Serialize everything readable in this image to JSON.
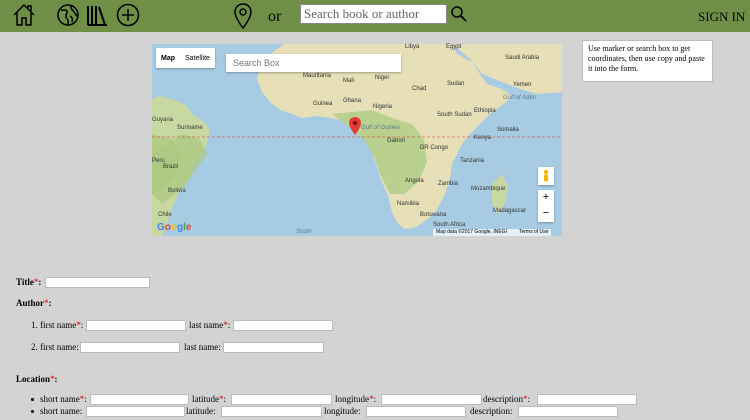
{
  "header": {
    "or_text": "or",
    "search_placeholder": "Search book or author",
    "sign_in": "SIGN IN"
  },
  "map": {
    "type_map": "Map",
    "type_satellite": "Satellite",
    "search_placeholder": "Search Box",
    "google_logo": "Google",
    "attribution": "Map data ©2017 Google, INEGI",
    "terms": "Terms of Use",
    "zoom_in": "+",
    "zoom_out": "−",
    "labels": {
      "libya": "Libya",
      "egypt": "Egypt",
      "mauritania": "Mauritania",
      "mali": "Mali",
      "niger": "Niger",
      "chad": "Chad",
      "sudan": "Sudan",
      "saudi_arabia": "Saudi Arabia",
      "yemen": "Yemen",
      "guinea": "Guinea",
      "ghana": "Ghana",
      "nigeria": "Nigeria",
      "gulf_aden": "Gulf of Aden",
      "ethiopia": "Ethiopia",
      "south_sudan": "South Sudan",
      "gulf_guinea": "Gulf of Guinea",
      "somalia": "Somalia",
      "guyana": "Guyana",
      "suriname": "Suriname",
      "gabon": "Gabon",
      "dr_congo": "DR Congo",
      "kenya": "Kenya",
      "tanzania": "Tanzania",
      "peru": "Peru",
      "brazil": "Brazil",
      "angola": "Angola",
      "zambia": "Zambia",
      "bolivia": "Bolivia",
      "mozambique": "Mozambique",
      "namibia": "Namibia",
      "madagascar": "Madagascar",
      "botswana": "Botswana",
      "chile": "Chile",
      "south_africa": "South Africa",
      "south_atlantic": "South"
    }
  },
  "hint": "Use marker or search box to get coordinates, then use copy and paste it into the form.",
  "form": {
    "title_label": "Title",
    "author_label": "Author",
    "required_mark": "*",
    "colon": ":",
    "author_rows": [
      {
        "num": "1.",
        "first": "first name",
        "last": "last name",
        "required": true
      },
      {
        "num": "2.",
        "first": "first name:",
        "last": "last name:",
        "required": false
      }
    ],
    "location_label": "Location",
    "location_fields": {
      "short_name": "short name",
      "latitude": "latitude",
      "longitude": "longitude",
      "description": "description"
    },
    "location_fields_row2": {
      "short_name": "short name:",
      "latitude": "latitude:",
      "longitude": "longitude:",
      "description": "description:"
    }
  },
  "colors": {
    "header_bg": "#6e8f45",
    "page_bg": "#d3d3d3",
    "required": "#dd0000",
    "marker": "#e53935"
  },
  "icons": [
    "home-icon",
    "globe-icon",
    "library-icon",
    "add-circle-icon",
    "location-pin-icon",
    "search-icon",
    "map-marker-icon",
    "pegman-icon"
  ]
}
